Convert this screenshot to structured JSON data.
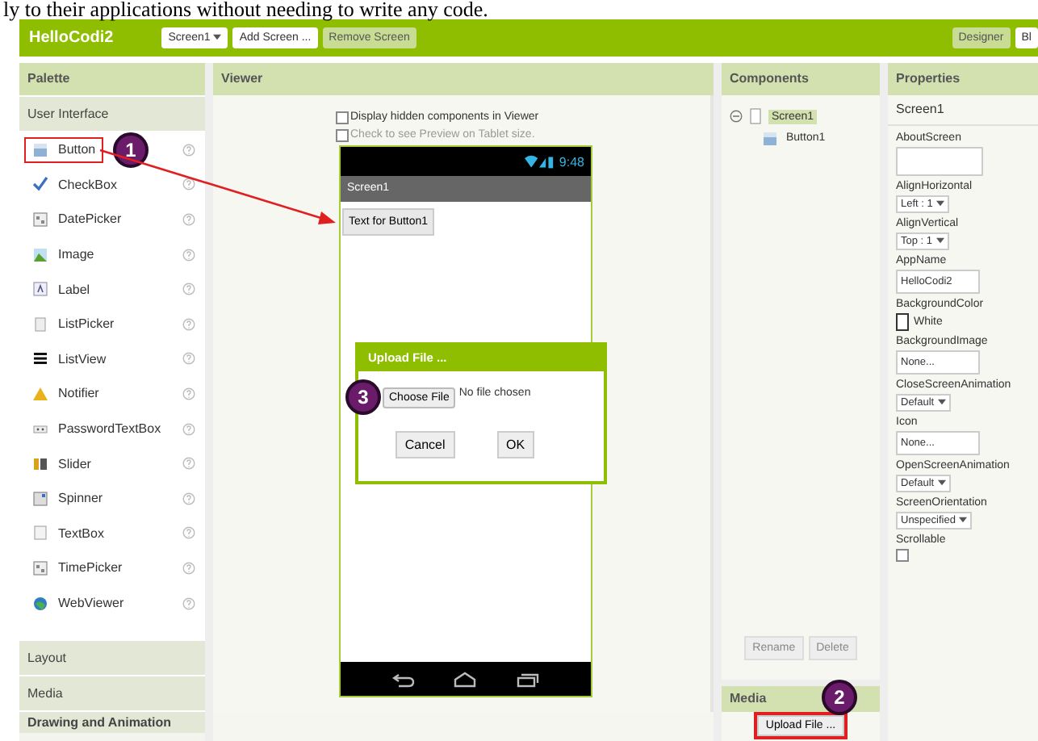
{
  "caption": "ly to their applications without needing to write any code.",
  "header": {
    "app_name": "HelloCodi2",
    "buttons": [
      {
        "label": "Screen1",
        "kind": "dropdown",
        "disabled": false
      },
      {
        "label": "Add Screen ...",
        "kind": "plain",
        "disabled": false
      },
      {
        "label": "Remove Screen",
        "kind": "plain",
        "disabled": true
      }
    ],
    "right_buttons": [
      {
        "label": "Designer",
        "selected": true
      },
      {
        "label": "Bl",
        "selected": false
      }
    ]
  },
  "palette": {
    "title": "Palette",
    "sections": [
      {
        "label": "User Interface",
        "expanded": true,
        "items": [
          {
            "label": "Button",
            "marked": true,
            "callout": "1"
          },
          {
            "label": "CheckBox",
            "marked": false
          },
          {
            "label": "DatePicker",
            "marked": false
          },
          {
            "label": "Image",
            "marked": false
          },
          {
            "label": "Label",
            "marked": false
          },
          {
            "label": "ListPicker",
            "marked": false
          },
          {
            "label": "ListView",
            "marked": false
          },
          {
            "label": "Notifier",
            "marked": false
          },
          {
            "label": "PasswordTextBox",
            "marked": false
          },
          {
            "label": "Slider",
            "marked": false
          },
          {
            "label": "Spinner",
            "marked": false
          },
          {
            "label": "TextBox",
            "marked": false
          },
          {
            "label": "TimePicker",
            "marked": false
          },
          {
            "label": "WebViewer",
            "marked": false
          }
        ]
      },
      {
        "label": "Layout",
        "expanded": false
      },
      {
        "label": "Media",
        "expanded": false
      },
      {
        "label": "Drawing and Animation",
        "expanded": false
      }
    ]
  },
  "viewer": {
    "title": "Viewer",
    "options": [
      {
        "label": "Display hidden components in Viewer",
        "checked": false,
        "disabled": false
      },
      {
        "label": "Check to see Preview on Tablet size.",
        "checked": false,
        "disabled": true
      }
    ],
    "phone": {
      "time": "9:48",
      "title": "Screen1",
      "button": "Text for Button1"
    },
    "dialog": {
      "title": "Upload File ...",
      "choose": "Choose File",
      "callout": "3",
      "status": "No file chosen",
      "buttons": [
        "Cancel",
        "OK"
      ]
    }
  },
  "components": {
    "title": "Components",
    "tree": [
      {
        "label": "Screen1",
        "selected": true,
        "expanded": true,
        "children": [
          {
            "label": "Button1",
            "selected": false
          }
        ]
      }
    ],
    "buttons": [
      "Rename",
      "Delete"
    ]
  },
  "media": {
    "title": "Media",
    "button": "Upload File ...",
    "marked": true,
    "callout": "2"
  },
  "properties": {
    "title": "Properties",
    "component": "Screen1",
    "items": [
      {
        "name": "AboutScreen",
        "kind": "textarea",
        "value": ""
      },
      {
        "name": "AlignHorizontal",
        "kind": "dropdown",
        "value": "Left : 1"
      },
      {
        "name": "AlignVertical",
        "kind": "dropdown",
        "value": "Top : 1"
      },
      {
        "name": "AppName",
        "kind": "text",
        "value": "HelloCodi2"
      },
      {
        "name": "BackgroundColor",
        "kind": "color",
        "value": "White",
        "color": "#ffffff"
      },
      {
        "name": "BackgroundImage",
        "kind": "text",
        "value": "None..."
      },
      {
        "name": "CloseScreenAnimation",
        "kind": "dropdown",
        "value": "Default"
      },
      {
        "name": "Icon",
        "kind": "text",
        "value": "None..."
      },
      {
        "name": "OpenScreenAnimation",
        "kind": "dropdown",
        "value": "Default"
      },
      {
        "name": "ScreenOrientation",
        "kind": "dropdown",
        "value": "Unspecified"
      },
      {
        "name": "Scrollable",
        "kind": "checkbox",
        "checked": false
      }
    ]
  }
}
